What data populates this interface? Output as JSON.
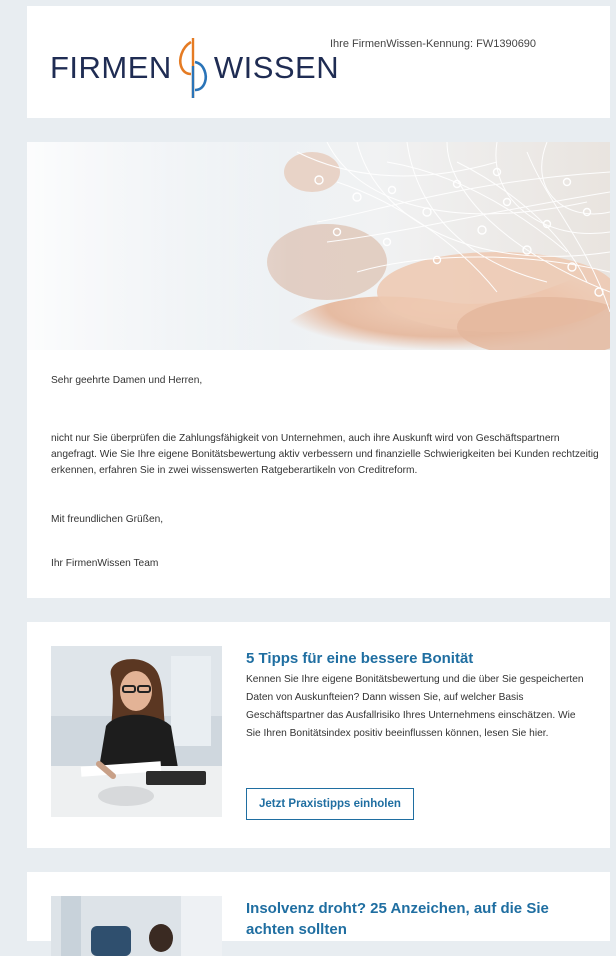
{
  "header": {
    "logo_left": "FIRMEN",
    "logo_right": "WISSEN",
    "kennung": "Ihre FirmenWissen-Kennung: FW1390690"
  },
  "body": {
    "greeting": "Sehr geehrte Damen und Herren,",
    "intro": "nicht nur Sie überprüfen die Zahlungsfähigkeit von Unternehmen, auch ihre Auskunft wird von Geschäftspartnern angefragt. Wie Sie Ihre eigene Bonitätsbewertung aktiv verbessern und finanzielle Schwierigkeiten bei Kunden rechtzeitig erkennen, erfahren Sie in zwei wissenswerten Ratgeberartikeln von Creditreform.",
    "closing": "Mit freundlichen Grüßen,",
    "signature": "Ihr FirmenWissen Team"
  },
  "articles": [
    {
      "title": "5 Tipps für eine bessere Bonität",
      "description": "Kennen Sie Ihre eigene Bonitätsbewertung und die über Sie gespeicherten Daten von Auskunfteien? Dann wissen Sie, auf welcher Basis Geschäftspartner das Ausfallrisiko Ihres Unternehmens einschätzen. Wie Sie Ihren Bonitätsindex positiv beeinflussen können, lesen Sie hier.",
      "cta": "Jetzt Praxistipps einholen"
    },
    {
      "title": "Insolvenz droht? 25 Anzeichen, auf die Sie achten sollten"
    }
  ],
  "colors": {
    "accent": "#1f6ea1",
    "logo_text": "#1f2c53",
    "logo_orange": "#e57b23",
    "logo_blue": "#2a74b8",
    "background": "#e8edf1"
  },
  "icons": {
    "logo_mark": "firmenwissen-logo-mark"
  }
}
